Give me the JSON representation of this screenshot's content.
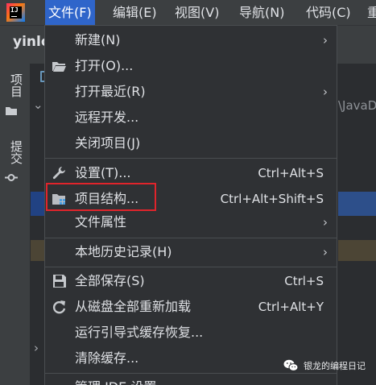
{
  "menubar": {
    "items": [
      {
        "label": "文件(F)",
        "active": true
      },
      {
        "label": "编辑(E)",
        "active": false
      },
      {
        "label": "视图(V)",
        "active": false
      },
      {
        "label": "导航(N)",
        "active": false
      },
      {
        "label": "代码(C)",
        "active": false
      },
      {
        "label": "重",
        "active": false
      }
    ]
  },
  "background": {
    "project_name": "yinlo",
    "left_tabs": {
      "project": "项目",
      "commit": "提交"
    },
    "editor_path_fragment": "\\JavaD"
  },
  "file_menu": {
    "items": [
      {
        "label": "新建(N)",
        "shortcut": "",
        "submenu": true,
        "icon": ""
      },
      {
        "label": "打开(O)...",
        "shortcut": "",
        "submenu": false,
        "icon": "folder-open-icon"
      },
      {
        "label": "打开最近(R)",
        "shortcut": "",
        "submenu": true,
        "icon": ""
      },
      {
        "label": "远程开发...",
        "shortcut": "",
        "submenu": false,
        "icon": ""
      },
      {
        "label": "关闭项目(J)",
        "shortcut": "",
        "submenu": false,
        "icon": ""
      },
      {
        "label": "设置(T)...",
        "shortcut": "Ctrl+Alt+S",
        "submenu": false,
        "icon": "wrench-icon"
      },
      {
        "label": "项目结构...",
        "shortcut": "Ctrl+Alt+Shift+S",
        "submenu": false,
        "icon": "project-structure-icon"
      },
      {
        "label": "文件属性",
        "shortcut": "",
        "submenu": true,
        "icon": ""
      },
      {
        "label": "本地历史记录(H)",
        "shortcut": "",
        "submenu": true,
        "icon": ""
      },
      {
        "label": "全部保存(S)",
        "shortcut": "Ctrl+S",
        "submenu": false,
        "icon": "save-icon"
      },
      {
        "label": "从磁盘全部重新加载",
        "shortcut": "Ctrl+Alt+Y",
        "submenu": false,
        "icon": "reload-icon"
      },
      {
        "label": "运行引导式缓存恢复...",
        "shortcut": "",
        "submenu": false,
        "icon": ""
      },
      {
        "label": "清除缓存...",
        "shortcut": "",
        "submenu": false,
        "icon": ""
      },
      {
        "label": "管理 IDE 设置",
        "shortcut": "",
        "submenu": true,
        "icon": ""
      }
    ],
    "submenu_arrow": "›"
  },
  "watermark": {
    "text": "银龙的编程日记"
  },
  "colors": {
    "accent": "#2f65ca",
    "highlight_border": "#e0242b",
    "menu_bg": "#2f3134"
  }
}
